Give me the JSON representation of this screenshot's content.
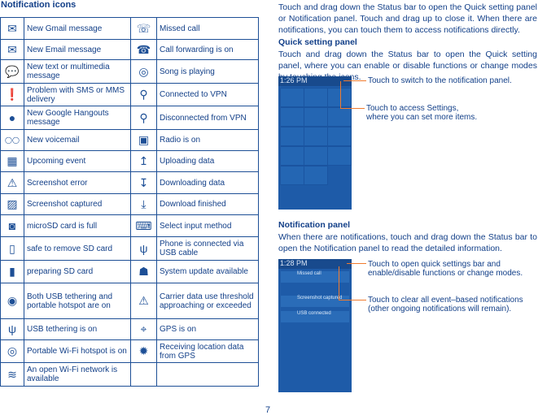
{
  "heading": "Notification icons",
  "rows": [
    [
      "mail-filled-icon",
      "New Gmail message",
      "missed-call-icon",
      "Missed call"
    ],
    [
      "mail-icon",
      "New Email message",
      "call-forward-icon",
      "Call forwarding is on"
    ],
    [
      "chat-icon",
      "New text or multimedia message",
      "disc-icon",
      "Song is playing"
    ],
    [
      "chat-alert-icon",
      "Problem with SMS or MMS delivery",
      "key-icon",
      "Connected to VPN"
    ],
    [
      "hangouts-icon",
      "New Google Hangouts message",
      "key-outline-icon",
      "Disconnected from VPN"
    ],
    [
      "voicemail-icon",
      "New voicemail",
      "radio-icon",
      "Radio is on"
    ],
    [
      "calendar-icon",
      "Upcoming event",
      "upload-icon",
      "Uploading data"
    ],
    [
      "screenshot-error-icon",
      "Screenshot error",
      "download-icon",
      "Downloading data"
    ],
    [
      "screenshot-icon",
      " Screenshot captured",
      "download-done-icon",
      "Download finished"
    ],
    [
      "sd-full-icon",
      "microSD card is full",
      "keyboard-icon",
      "Select input method"
    ],
    [
      "sd-remove-icon",
      "safe to remove SD card",
      "usb-icon",
      "Phone is connected via USB cable"
    ],
    [
      "sd-prepare-icon",
      "preparing SD card",
      "android-icon",
      "System update available"
    ],
    [
      "usb-hotspot-icon",
      "Both USB tethering and portable hotspot are on",
      "warning-icon",
      "Carrier data use threshold approaching or exceeded"
    ],
    [
      "usb-tether-icon",
      "USB tethering is on",
      "gps-icon",
      "GPS is on"
    ],
    [
      "hotspot-icon",
      "Portable Wi-Fi hotspot is on",
      "gps-receiving-icon",
      "Receiving location data from GPS"
    ],
    [
      "wifi-icon",
      "An open Wi-Fi network is available",
      "",
      ""
    ]
  ],
  "intro": "Touch and drag down the Status bar to open the Quick setting panel or Notification panel. Touch and drag up to close it. When there are notifications, you can touch them to access notifications directly.",
  "quick": {
    "title": "Quick setting panel",
    "text": "Touch and drag down the Status bar to open the Quick setting panel, where you can enable or disable functions or change modes by touching the icons.",
    "time": "1:26 PM",
    "callout1": "Touch to switch to the notification panel.",
    "callout2": "Touch to access Settings,\nwhere you can set more items."
  },
  "notif": {
    "title": "Notification panel",
    "text": "When there are notifications, touch and drag down the Status bar to open the Notification panel to read the detailed information.",
    "time": "1:28 PM",
    "callout1": "Touch to open quick settings bar and\nenable/disable functions or change modes.",
    "callout2": "Touch to clear all event–based notifications\n(other ongoing notifications will remain).",
    "cards": [
      "Missed call",
      "Screenshot captured",
      "USB connected"
    ]
  },
  "page_number": "7"
}
